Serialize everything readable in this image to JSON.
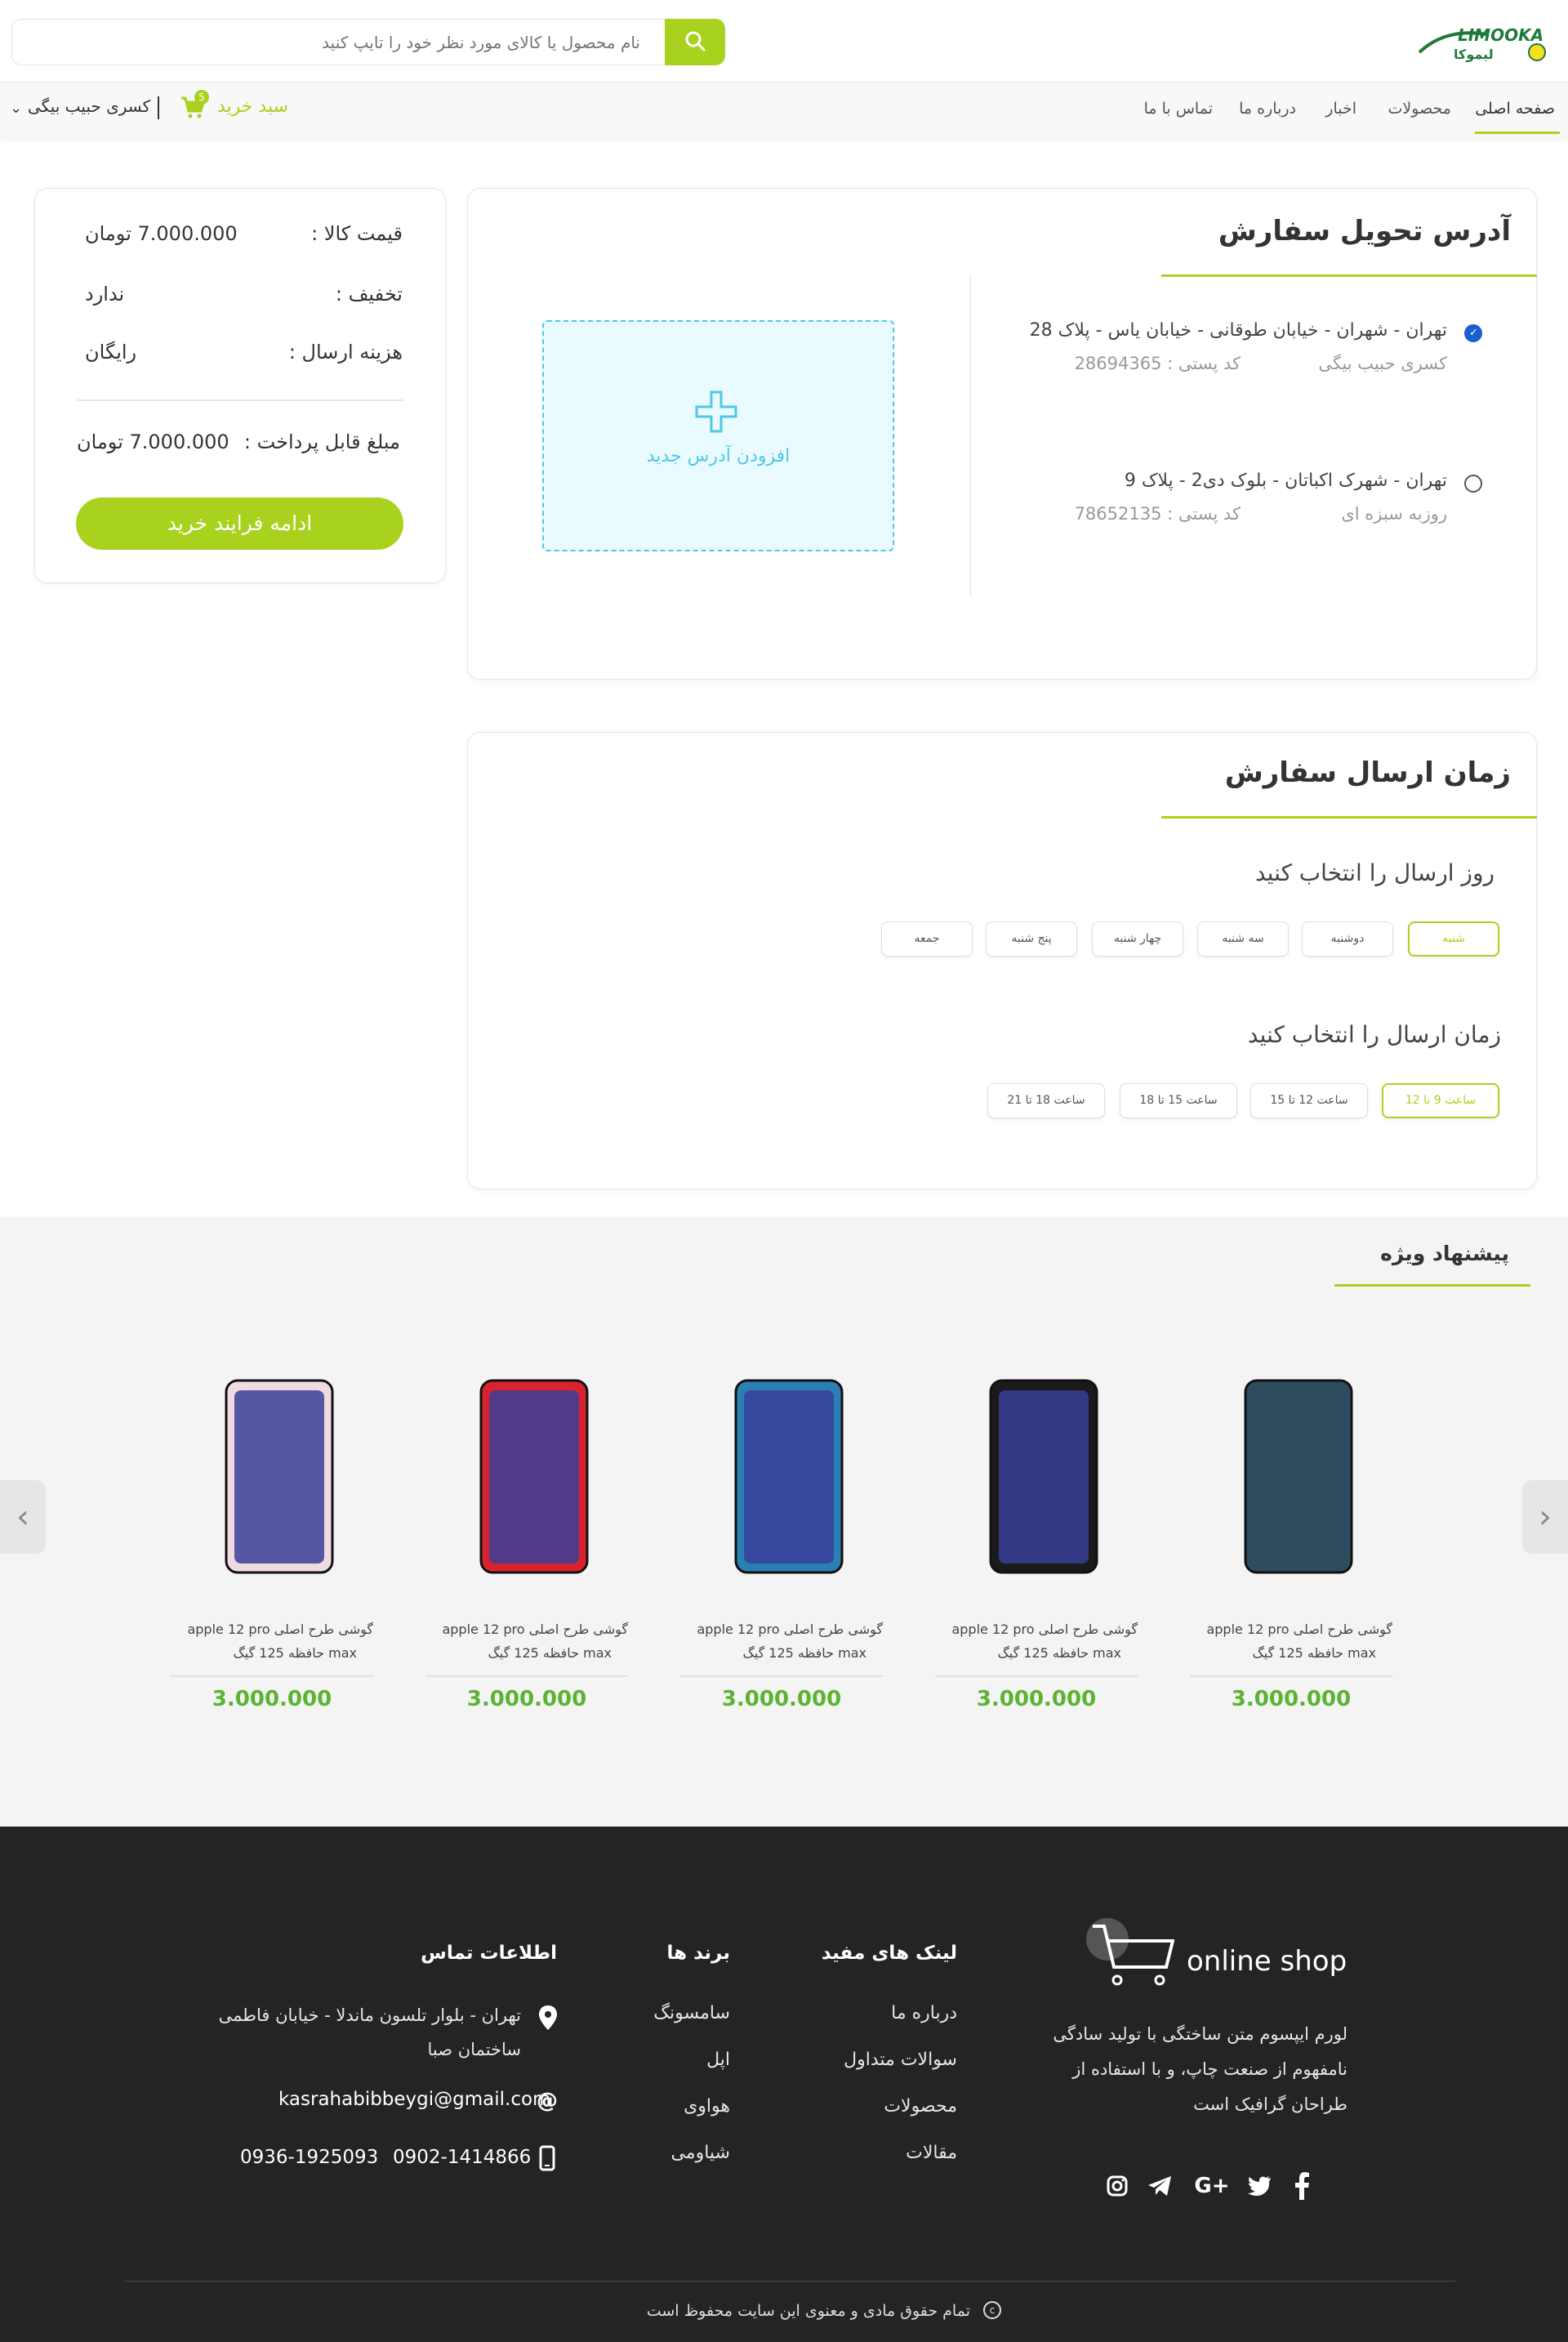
{
  "header": {
    "logo_text": "LIMOOKA",
    "search_placeholder": "نام محصول یا کالای مورد نظر خود را تایپ کنید",
    "nav": [
      "صفحه اصلی",
      "محصولات",
      "اخبار",
      "درباره ما",
      "تماس با ما"
    ],
    "active_nav": "صفحه اصلی",
    "cart_label": "سبد خرید",
    "cart_count": "5",
    "user_name": "کسری حبیب بیگی"
  },
  "summary": {
    "price_label": "قیمت کالا :",
    "price_value": "7.000.000  تومان",
    "discount_label": "تخفیف :",
    "discount_value": "ندارد",
    "shipping_label": "هزینه ارسال :",
    "shipping_value": "رایگان",
    "payable_label": "مبلغ قابل پرداخت :",
    "payable_value": "7.000.000 تومان",
    "checkout_button": "ادامه فرایند خرید"
  },
  "address": {
    "title": "آدرس تحویل سفارش",
    "items": [
      {
        "line": "تهران - شهران - خیابان طوقانی - خیابان یاس - پلاک 28",
        "name": "کسری حبیب بیگی",
        "postal": "کد پستی : 28694365",
        "selected": true
      },
      {
        "line": "تهران - شهرک اکباتان - بلوک دی2 - پلاک 9",
        "name": "روزبه سبزه ای",
        "postal": "کد پستی : 78652135",
        "selected": false
      }
    ],
    "add_label": "افزودن آدرس جدید"
  },
  "delivery": {
    "title": "زمان ارسال سفارش",
    "day_prompt": "روز ارسال را انتخاب کنید",
    "days": [
      "شنبه",
      "دوشنبه",
      "سه شنبه",
      "چهار شنبه",
      "پنج شنبه",
      "جمعه"
    ],
    "selected_day": "شنبه",
    "time_prompt": "زمان ارسال را انتخاب کنید",
    "times": [
      "ساعت 9 تا 12",
      "ساعت 12 تا 15",
      "ساعت 15 تا 18",
      "ساعت 18 تا 21"
    ],
    "selected_time": "ساعت 9 تا 12"
  },
  "offers": {
    "title": "پیشنهاد ویژه",
    "products": [
      {
        "name_line1": "گوشی طرح اصلی  apple 12 pro",
        "name_line2": "max حافظه 125 گیگ",
        "price": "3.000.000",
        "color": "#2f4b5e"
      },
      {
        "name_line1": "گوشی طرح اصلی  apple 12 pro",
        "name_line2": "max حافظه 125 گیگ",
        "price": "3.000.000",
        "color": "#1a1a1a"
      },
      {
        "name_line1": "گوشی طرح اصلی  apple 12 pro",
        "name_line2": "max حافظه 125 گیگ",
        "price": "3.000.000",
        "color": "#2a7fb3"
      },
      {
        "name_line1": "گوشی طرح اصلی  apple 12 pro",
        "name_line2": "max حافظه 125 گیگ",
        "price": "3.000.000",
        "color": "#d8222d"
      },
      {
        "name_line1": "گوشی طرح اصلی  apple 12 pro",
        "name_line2": "max حافظه 125 گیگ",
        "price": "3.000.000",
        "color": "#f1dbe3"
      }
    ]
  },
  "footer": {
    "brand": "online shop",
    "about_lines": [
      "لورم ایپسوم متن ساختگی با تولید سادگی",
      "نامفهوم از صنعت چاپ، و با استفاده از",
      "طراحان گرافیک است"
    ],
    "links_title": "لینک های مفید",
    "links": [
      "درباره ما",
      "سوالات متداول",
      "محصولات",
      "مقالات"
    ],
    "brands_title": "برند ها",
    "brands": [
      "سامسونگ",
      "اپل",
      "هواوی",
      "شیاومی"
    ],
    "contact_title": "اطلاعات تماس",
    "address_line1": "تهران - بلوار تلسون ماندلا - خیابان فاطمی",
    "address_line2": "ساختمان صبا",
    "email": "kasrahabibbeygi@gmail.com",
    "phone1": "0902-1414866",
    "phone2": "0936-1925093",
    "copyright": "تمام حقوق مادی و معنوی این سایت محفوظ است"
  }
}
